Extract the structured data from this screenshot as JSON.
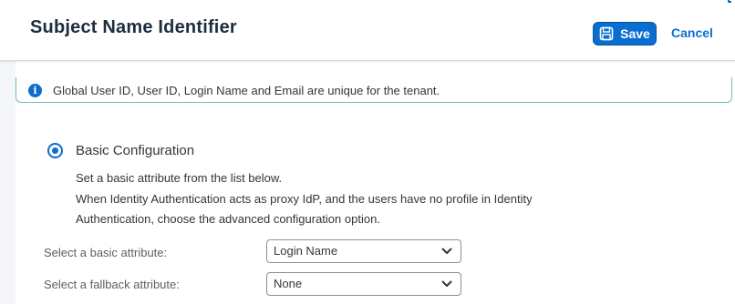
{
  "header": {
    "title": "Subject Name Identifier",
    "save_label": "Save",
    "cancel_label": "Cancel"
  },
  "info": {
    "icon": "info-icon",
    "message": "Global User ID, User ID, Login Name and Email are unique for the tenant."
  },
  "basic_config": {
    "label": "Basic Configuration",
    "selected": true,
    "description": [
      "Set a basic attribute from the list below.",
      "When Identity Authentication acts as proxy IdP, and the users have no profile in Identity",
      "Authentication, choose the advanced configuration option."
    ]
  },
  "fields": {
    "basic_attribute": {
      "label": "Select a basic attribute:",
      "value": "Login Name"
    },
    "fallback_attribute": {
      "label": "Select a fallback attribute:",
      "value": "None"
    }
  },
  "colors": {
    "accent": "#0a6ed1",
    "info_border": "#6bbfc3",
    "title": "#1d2d3e"
  }
}
